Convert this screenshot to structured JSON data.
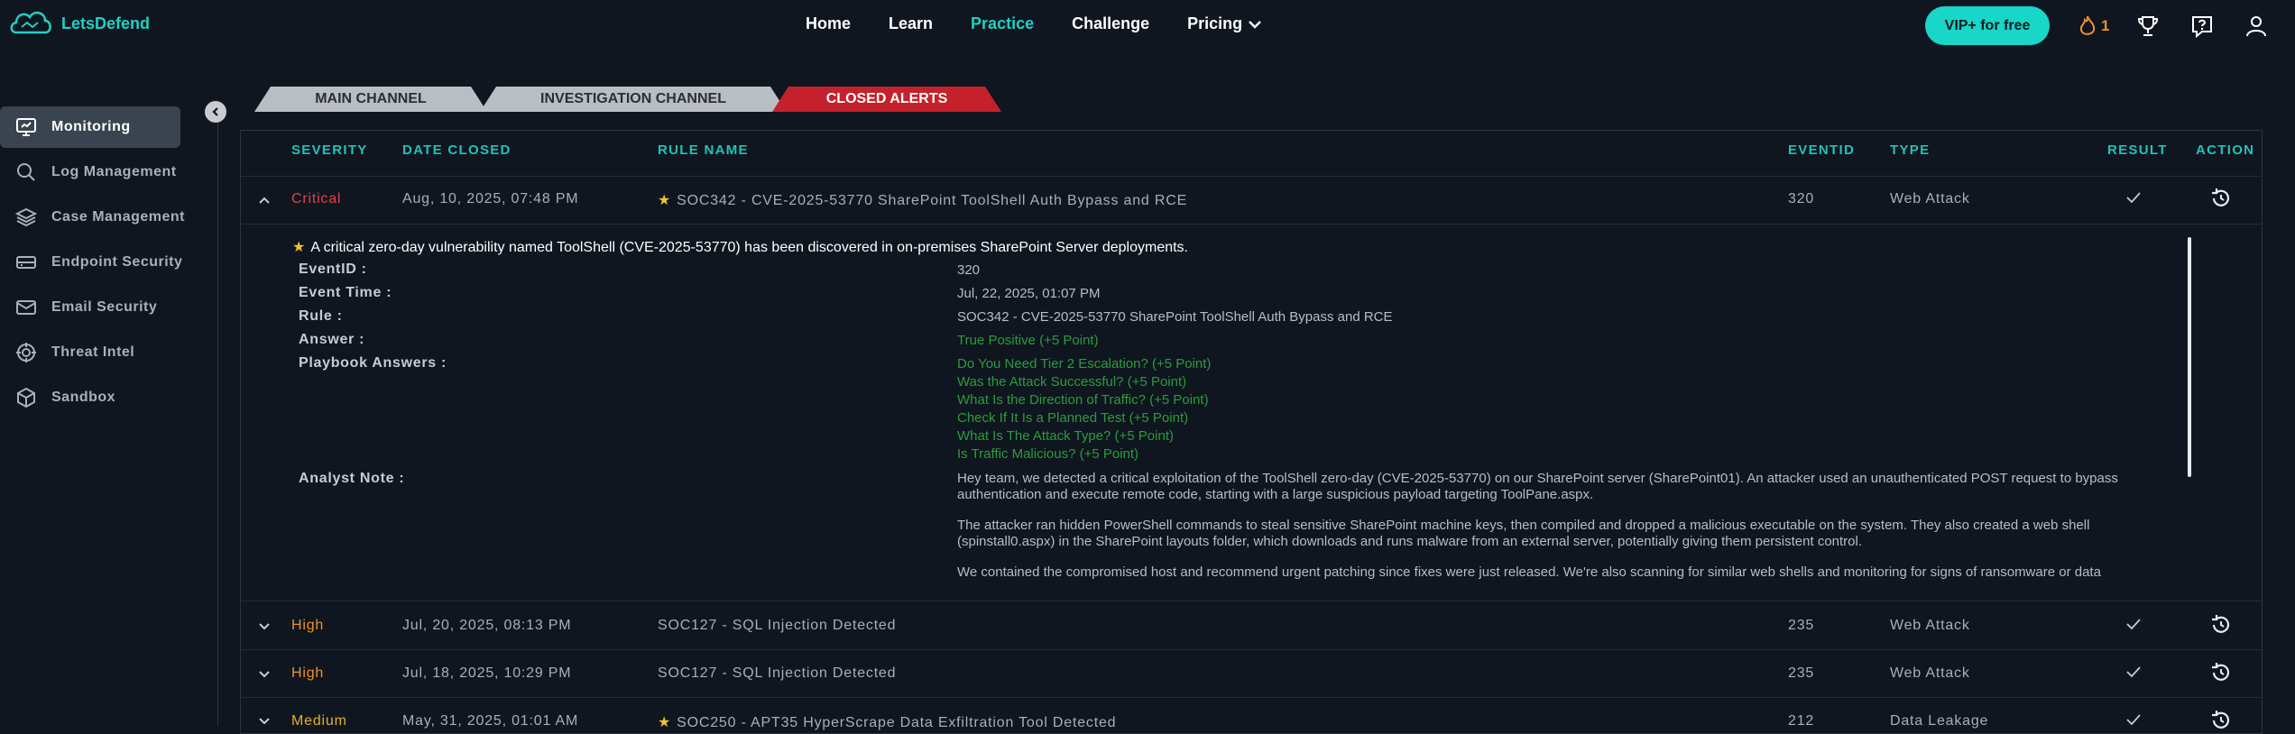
{
  "brand": "LetsDefend",
  "nav": {
    "home": "Home",
    "learn": "Learn",
    "practice": "Practice",
    "challenge": "Challenge",
    "pricing": "Pricing"
  },
  "vip_label": "VIP+ for free",
  "streak_count": "1",
  "sidebar": [
    {
      "label": "Monitoring",
      "icon": "monitor-icon"
    },
    {
      "label": "Log Management",
      "icon": "search-icon"
    },
    {
      "label": "Case Management",
      "icon": "layers-icon"
    },
    {
      "label": "Endpoint Security",
      "icon": "drive-icon"
    },
    {
      "label": "Email Security",
      "icon": "mail-icon"
    },
    {
      "label": "Threat Intel",
      "icon": "target-icon"
    },
    {
      "label": "Sandbox",
      "icon": "cube-icon"
    }
  ],
  "tabs": {
    "main": "MAIN CHANNEL",
    "investigation": "INVESTIGATION CHANNEL",
    "closed": "CLOSED ALERTS"
  },
  "columns": {
    "severity": "SEVERITY",
    "date": "DATE CLOSED",
    "rule": "RULE NAME",
    "eventid": "EVENTID",
    "type": "TYPE",
    "result": "RESULT",
    "action": "ACTION"
  },
  "alerts": [
    {
      "severity": "Critical",
      "date": "Aug, 10, 2025, 07:48 PM",
      "rule": "SOC342 - CVE-2025-53770 SharePoint ToolShell Auth Bypass and RCE",
      "eventid": "320",
      "type": "Web Attack"
    },
    {
      "severity": "High",
      "date": "Jul, 20, 2025, 08:13 PM",
      "rule": "SOC127 - SQL Injection Detected",
      "eventid": "235",
      "type": "Web Attack"
    },
    {
      "severity": "High",
      "date": "Jul, 18, 2025, 10:29 PM",
      "rule": "SOC127 - SQL Injection Detected",
      "eventid": "235",
      "type": "Web Attack"
    },
    {
      "severity": "Medium",
      "date": "May, 31, 2025, 01:01 AM",
      "rule": "SOC250 - APT35 HyperScrape Data Exfiltration Tool Detected",
      "eventid": "212",
      "type": "Data Leakage"
    }
  ],
  "detail": {
    "title": "A critical zero-day vulnerability named ToolShell (CVE-2025-53770) has been discovered in on-premises SharePoint Server deployments.",
    "labels": {
      "eventid": "EventID :",
      "event_time": "Event Time :",
      "rule": "Rule :",
      "answer": "Answer :",
      "playbook": "Playbook Answers :",
      "note": "Analyst Note :"
    },
    "eventid": "320",
    "event_time": "Jul, 22, 2025, 01:07 PM",
    "rule": "SOC342 - CVE-2025-53770 SharePoint ToolShell Auth Bypass and RCE",
    "answer": "True Positive (+5 Point)",
    "playbook": [
      "Do You Need Tier 2 Escalation? (+5 Point)",
      "Was the Attack Successful? (+5 Point)",
      "What Is the Direction of Traffic? (+5 Point)",
      "Check If It Is a Planned Test (+5 Point)",
      "What Is The Attack Type? (+5 Point)",
      "Is Traffic Malicious? (+5 Point)"
    ],
    "note": [
      "Hey team, we detected a critical exploitation of the ToolShell zero-day (CVE-2025-53770) on our SharePoint server (SharePoint01). An attacker used an unauthenticated POST request to bypass authentication and execute remote code, starting with a large suspicious payload targeting ToolPane.aspx.",
      "The attacker ran hidden PowerShell commands to steal sensitive SharePoint machine keys, then compiled and dropped a malicious executable on the system. They also created a web shell (spinstall0.aspx) in the SharePoint layouts folder, which downloads and runs malware from an external server, potentially giving them persistent control.",
      "We contained the compromised host and recommend urgent patching since fixes were just released. We're also scanning for similar web shells and monitoring for signs of ransomware or data"
    ]
  },
  "colors": {
    "accent": "#21d0c3",
    "critical": "#e0424a",
    "high": "#f0902a",
    "medium": "#e0b12a",
    "green": "#2a9c3a",
    "closed_tab": "#c5212c"
  }
}
